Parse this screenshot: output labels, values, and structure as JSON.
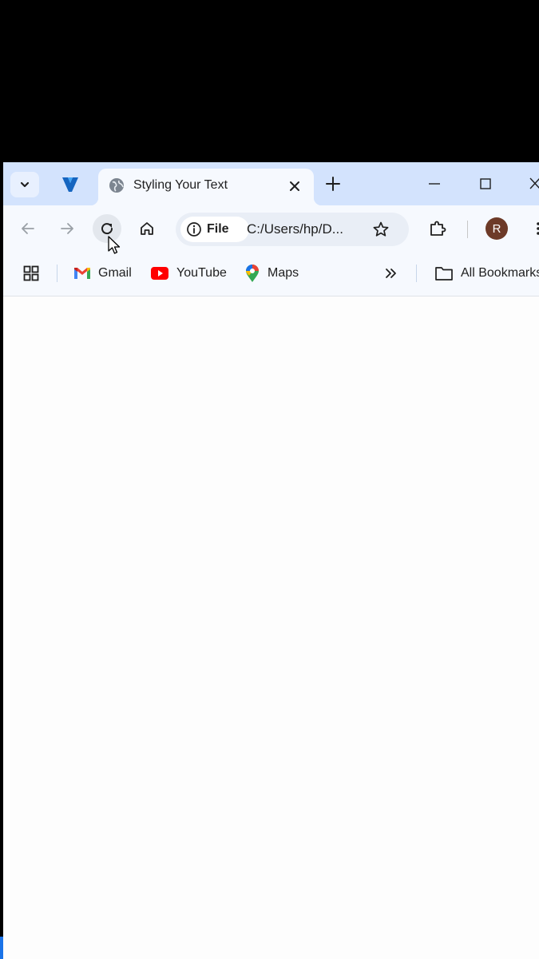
{
  "tab": {
    "title": "Styling Your Text",
    "favicon_icon": "globe-icon",
    "close_icon": "close-icon"
  },
  "tabstrip": {
    "search_icon": "chevron-down-icon",
    "pinned_icon": "y-logo-icon",
    "new_tab_icon": "plus-icon"
  },
  "window_controls": [
    "minimize-icon",
    "maximize-icon",
    "close-icon"
  ],
  "toolbar": {
    "back_icon": "arrow-left-icon",
    "forward_icon": "arrow-right-icon",
    "reload_icon": "reload-icon",
    "home_icon": "home-icon",
    "chip_label": "File",
    "url": "C:/Users/hp/D...",
    "bookmark_icon": "star-icon",
    "extensions_icon": "puzzle-icon",
    "avatar_letter": "R",
    "menu_icon": "kebab-menu-icon"
  },
  "bookmarks": {
    "apps_icon": "apps-grid-icon",
    "items": [
      {
        "label": "Gmail",
        "icon": "gmail-icon"
      },
      {
        "label": "YouTube",
        "icon": "youtube-icon"
      },
      {
        "label": "Maps",
        "icon": "maps-pin-icon"
      }
    ],
    "overflow_icon": "double-chevron-right-icon",
    "all_bookmarks_label": "All Bookmarks",
    "all_bookmarks_icon": "folder-icon"
  },
  "colors": {
    "tabstrip": "#d3e3fd",
    "toolbar": "#f6f9fe",
    "omnibox": "#e9eef6",
    "avatar": "#6d3a28",
    "page": "#fdfdfd"
  }
}
